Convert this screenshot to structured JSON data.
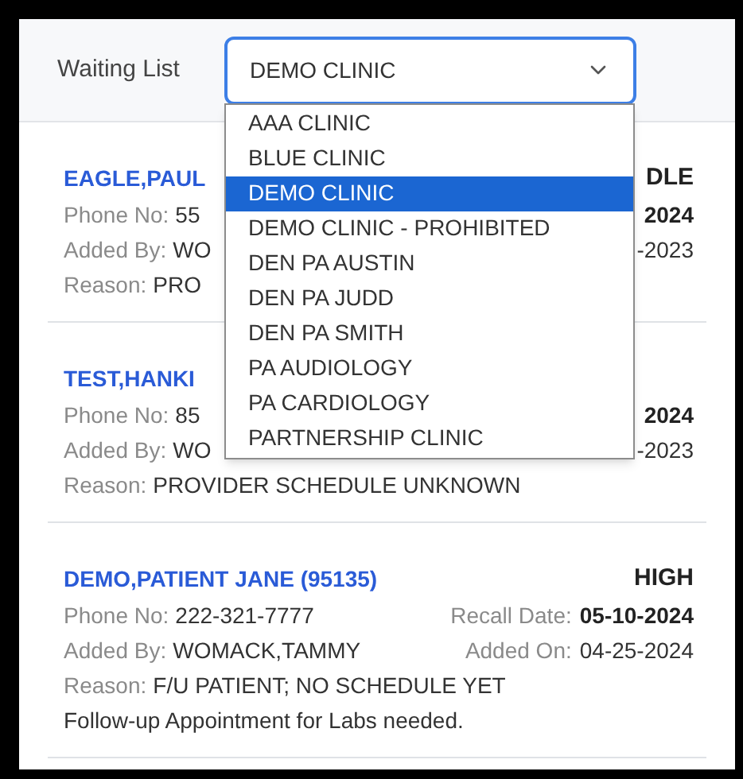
{
  "header": {
    "label": "Waiting List",
    "select": {
      "value": "DEMO CLINIC",
      "expanded": true
    }
  },
  "options": [
    {
      "label": "AAA CLINIC",
      "selected": false
    },
    {
      "label": "BLUE CLINIC",
      "selected": false
    },
    {
      "label": "DEMO CLINIC",
      "selected": true
    },
    {
      "label": "DEMO CLINIC - PROHIBITED",
      "selected": false
    },
    {
      "label": "DEN PA AUSTIN",
      "selected": false
    },
    {
      "label": "DEN PA JUDD",
      "selected": false
    },
    {
      "label": "DEN PA SMITH",
      "selected": false
    },
    {
      "label": "PA AUDIOLOGY",
      "selected": false
    },
    {
      "label": "PA CARDIOLOGY",
      "selected": false
    },
    {
      "label": "PARTNERSHIP CLINIC",
      "selected": false
    }
  ],
  "entries": [
    {
      "name": "EAGLE,PAUL",
      "priority": "DLE",
      "lines": [
        {
          "left": [
            {
              "kind": "label",
              "text": "Phone No:"
            },
            {
              "kind": "value",
              "text": "55"
            }
          ],
          "right": [
            {
              "kind": "bold",
              "text": "2024"
            }
          ]
        },
        {
          "left": [
            {
              "kind": "label",
              "text": "Added By:"
            },
            {
              "kind": "value",
              "text": "WO"
            }
          ],
          "right": [
            {
              "kind": "value",
              "text": "-2023"
            }
          ]
        },
        {
          "left": [
            {
              "kind": "label",
              "text": "Reason:"
            },
            {
              "kind": "value",
              "text": "PRO"
            }
          ]
        }
      ]
    },
    {
      "name": "TEST,HANKI",
      "lines": [
        {
          "left": [
            {
              "kind": "label",
              "text": "Phone No:"
            },
            {
              "kind": "value",
              "text": "85"
            }
          ],
          "right": [
            {
              "kind": "bold",
              "text": "2024"
            }
          ]
        },
        {
          "left": [
            {
              "kind": "label",
              "text": "Added By:"
            },
            {
              "kind": "value",
              "text": "WO"
            }
          ],
          "right": [
            {
              "kind": "value",
              "text": "-2023"
            }
          ]
        },
        {
          "left": [
            {
              "kind": "label",
              "text": "Reason:"
            },
            {
              "kind": "value",
              "text": "PROVIDER SCHEDULE UNKNOWN"
            }
          ]
        }
      ]
    },
    {
      "name": "DEMO,PATIENT JANE (95135)",
      "priority": "HIGH",
      "lines": [
        {
          "left": [
            {
              "kind": "label",
              "text": "Phone No:"
            },
            {
              "kind": "value",
              "text": "222-321-7777"
            }
          ],
          "right": [
            {
              "kind": "label",
              "text": "Recall Date:"
            },
            {
              "kind": "bold",
              "text": "05-10-2024"
            }
          ]
        },
        {
          "left": [
            {
              "kind": "label",
              "text": "Added By:"
            },
            {
              "kind": "value",
              "text": "WOMACK,TAMMY"
            }
          ],
          "right": [
            {
              "kind": "label",
              "text": "Added On:"
            },
            {
              "kind": "value",
              "text": "04-25-2024"
            }
          ]
        },
        {
          "left": [
            {
              "kind": "label",
              "text": "Reason:"
            },
            {
              "kind": "value",
              "text": "F/U PATIENT; NO SCHEDULE YET"
            }
          ]
        },
        {
          "left": [
            {
              "kind": "value",
              "text": "Follow-up Appointment for Labs needed."
            }
          ]
        }
      ]
    }
  ]
}
